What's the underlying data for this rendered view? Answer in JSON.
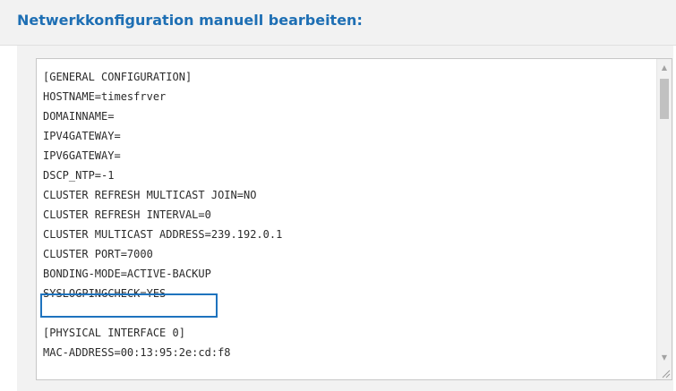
{
  "header": {
    "title": "Netwerkkonfiguration manuell bearbeiten:"
  },
  "editor": {
    "lines": [
      "[GENERAL CONFIGURATION]",
      "HOSTNAME=timesfrver",
      "DOMAINNAME=",
      "IPV4GATEWAY=",
      "IPV6GATEWAY=",
      "DSCP_NTP=-1",
      "CLUSTER REFRESH MULTICAST JOIN=NO",
      "CLUSTER REFRESH INTERVAL=0",
      "CLUSTER MULTICAST ADDRESS=239.192.0.1",
      "CLUSTER PORT=7000",
      "BONDING-MODE=ACTIVE-BACKUP",
      "SYSLOGPINGCHECK=YES",
      "",
      "[PHYSICAL INTERFACE 0]",
      "MAC-ADDRESS=00:13:95:2e:cd:f8"
    ],
    "highlighted_line": "SYSLOGPINGCHECK=YES"
  },
  "scrollbar": {
    "up_icon": "scroll-up-arrow-icon",
    "down_icon": "scroll-down-arrow-icon"
  },
  "colors": {
    "title": "#1e6fb4",
    "highlight_border": "#1e73be",
    "panel_background": "#f2f2f2"
  }
}
